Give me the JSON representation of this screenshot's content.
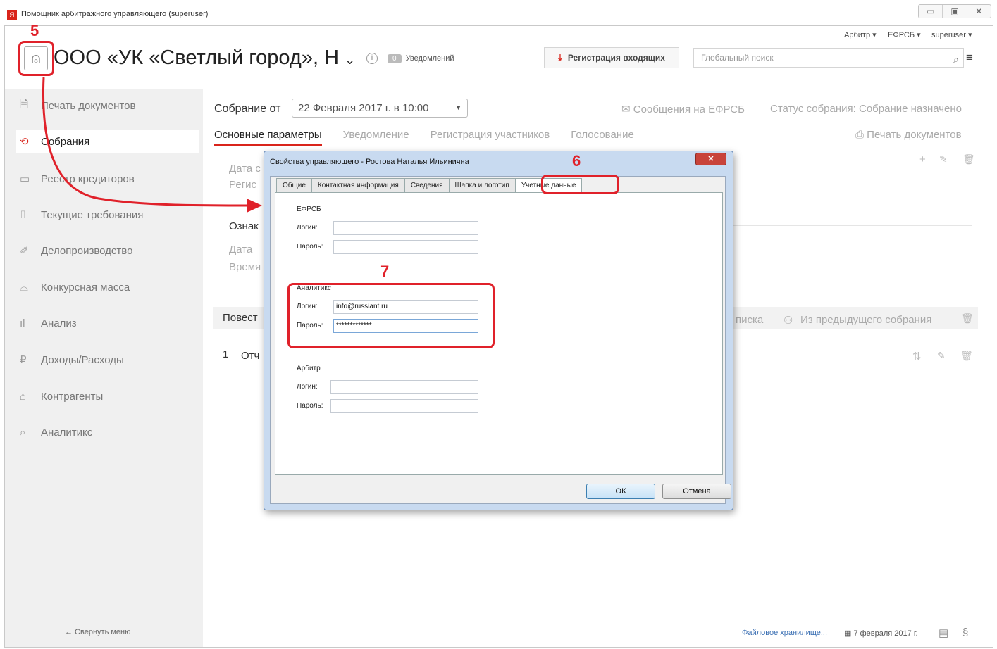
{
  "window": {
    "title": "Помощник арбитражного управляющего (superuser)",
    "app_icon": "Я",
    "controls": [
      "▭",
      "▣",
      "✕"
    ]
  },
  "header": {
    "menu": [
      "Арбитр ▾",
      "ЕФРСБ ▾",
      "superuser ▾"
    ],
    "org_title": "ООО «УК «Светлый город», Н",
    "org_caret": "⌄",
    "info": "i",
    "notif_count": "0",
    "notif_label": "Уведомлений",
    "register_label": "Регистрация входящих",
    "search_placeholder": "Глобальный поиск"
  },
  "annotations": {
    "n5": "5",
    "n6": "6",
    "n7": "7",
    "color": "#e0212a"
  },
  "sidebar": {
    "items": [
      {
        "label": "Печать документов",
        "icon": "🗎"
      },
      {
        "label": "Собрания",
        "icon": "⟲"
      },
      {
        "label": "Реестр кредиторов",
        "icon": "▭"
      },
      {
        "label": "Текущие требования",
        "icon": "⌷"
      },
      {
        "label": "Делопроизводство",
        "icon": "✐"
      },
      {
        "label": "Конкурсная масса",
        "icon": "⌓"
      },
      {
        "label": "Анализ",
        "icon": "ıl"
      },
      {
        "label": "Доходы/Расходы",
        "icon": "₽"
      },
      {
        "label": "Контрагенты",
        "icon": "⌂"
      },
      {
        "label": "Аналитикс",
        "icon": "⌕"
      }
    ],
    "collapse": "←  Свернуть меню"
  },
  "main": {
    "meeting_label": "Собрание от",
    "meeting_value": "22 Февраля 2017 г. в 10:00",
    "efrsb_messages": "✉  Сообщения на ЕФРСБ",
    "status": "Статус собрания: Собрание назначено",
    "tabs": [
      "Основные параметры",
      "Уведомление",
      "Регистрация участников",
      "Голосование"
    ],
    "print_docs": "Печать документов",
    "bg_labels": [
      "Дата с",
      "Регис",
      "Ознак",
      "Дата",
      "Время",
      "Повест",
      "1",
      "Отч"
    ],
    "bg_right": [
      "писка",
      "Из предыдущего собрания"
    ]
  },
  "footer": {
    "storage_link": "Файловое хранилище...",
    "date": "7 февраля 2017 г.",
    "section_icon": "§"
  },
  "dialog": {
    "title": "Свойства управляющего - Ростова Наталья Ильинична",
    "close": "✕",
    "tabs": [
      "Общие",
      "Контактная информация",
      "Сведения",
      "Шапка и логотип",
      "Учетные данные"
    ],
    "groups": [
      {
        "title": "ЕФРСБ",
        "login_label": "Логин:",
        "password_label": "Пароль:",
        "login": "",
        "password": ""
      },
      {
        "title": "Аналитикс",
        "login_label": "Логин:",
        "password_label": "Пароль:",
        "login": "info@russiant.ru",
        "password": "*************"
      },
      {
        "title": "Арбитр",
        "login_label": "Логин:",
        "password_label": "Пароль:",
        "login": "",
        "password": ""
      }
    ],
    "ok": "ОК",
    "cancel": "Отмена"
  }
}
